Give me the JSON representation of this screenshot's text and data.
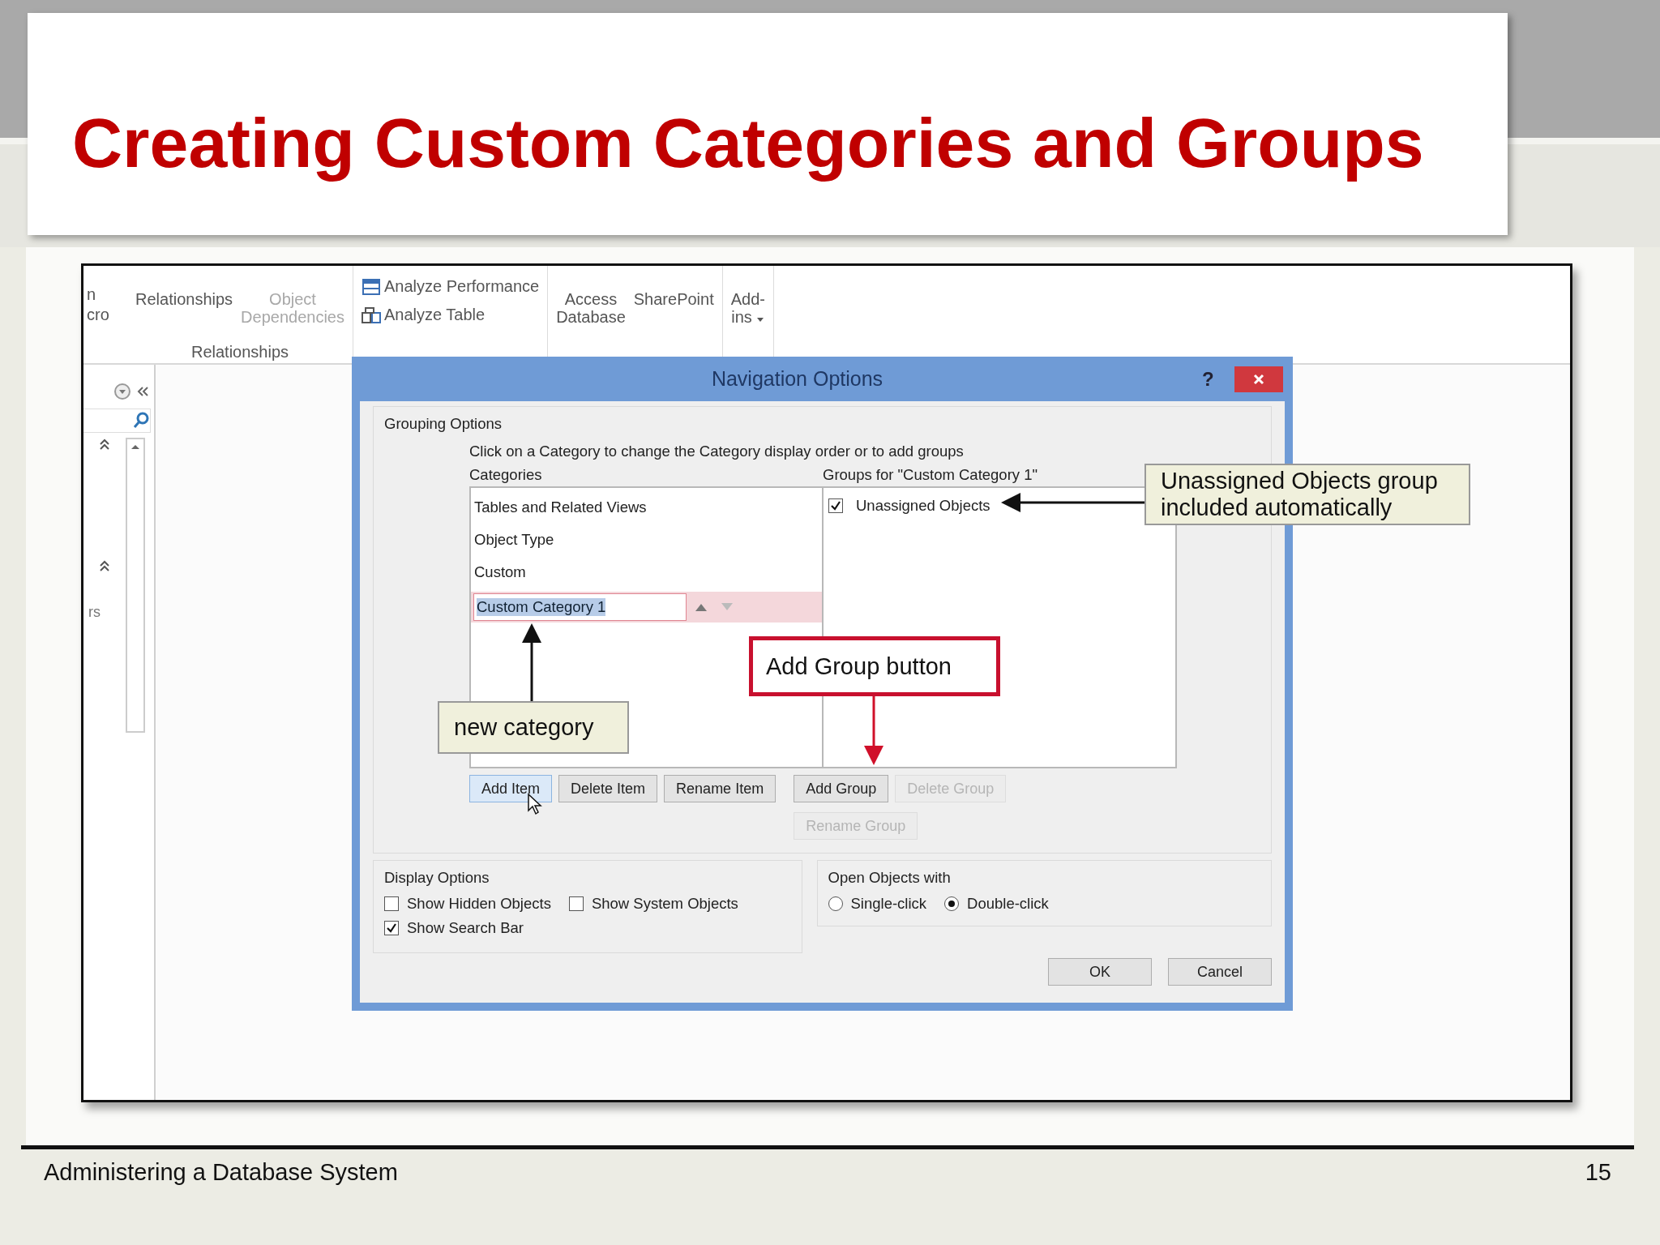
{
  "slide": {
    "title": "Creating Custom Categories and Groups",
    "footer": "Administering a Database System",
    "page_number": "15"
  },
  "ribbon": {
    "cut_labels": [
      "n",
      "cro"
    ],
    "groups": [
      {
        "label": "Relationships",
        "buttons": [
          {
            "lines": [
              "Relationships"
            ],
            "disabled": false,
            "dropdown": false
          },
          {
            "lines": [
              "Object",
              "Dependencies"
            ],
            "disabled": true,
            "dropdown": false
          }
        ]
      },
      {
        "small_buttons": [
          {
            "label": "Analyze Performance",
            "kind": "performance"
          },
          {
            "label": "Analyze Table",
            "kind": "table"
          }
        ]
      },
      {
        "buttons": [
          {
            "lines": [
              "Access",
              "Database"
            ],
            "disabled": false,
            "dropdown": false
          },
          {
            "lines": [
              "SharePoint"
            ],
            "disabled": false,
            "dropdown": false
          }
        ]
      },
      {
        "buttons": [
          {
            "lines": [
              "Add-",
              "ins"
            ],
            "disabled": false,
            "dropdown": true
          }
        ]
      }
    ]
  },
  "nav_pane": {
    "cut_label": "rs"
  },
  "dialog": {
    "title": "Navigation Options",
    "help": "?",
    "grouping": {
      "legend": "Grouping Options",
      "instruction": "Click on a Category to change the Category display order or to add groups",
      "categories_label": "Categories",
      "groups_label": "Groups for \"Custom Category 1\"",
      "categories": [
        {
          "label": "Tables and Related Views",
          "selected": false
        },
        {
          "label": "Object Type",
          "selected": false
        },
        {
          "label": "Custom",
          "selected": false
        },
        {
          "label": "Custom Category 1",
          "selected": true
        }
      ],
      "groups": [
        {
          "label": "Unassigned Objects",
          "checked": true
        }
      ],
      "category_buttons": [
        {
          "label": "Add Item",
          "disabled": false,
          "hovered": true
        },
        {
          "label": "Delete Item",
          "disabled": false,
          "hovered": false
        },
        {
          "label": "Rename Item",
          "disabled": false,
          "hovered": false
        }
      ],
      "group_buttons": [
        {
          "label": "Add Group",
          "disabled": false,
          "hovered": false
        },
        {
          "label": "Delete Group",
          "disabled": true,
          "hovered": false
        },
        {
          "label": "Rename Group",
          "disabled": true,
          "hovered": false
        }
      ]
    },
    "display_options": {
      "legend": "Display Options",
      "checkboxes": [
        {
          "label": "Show Hidden Objects",
          "checked": false
        },
        {
          "label": "Show System Objects",
          "checked": false
        },
        {
          "label": "Show Search Bar",
          "checked": true
        }
      ]
    },
    "open_objects": {
      "legend": "Open Objects with",
      "radios": [
        {
          "label": "Single-click",
          "selected": false
        },
        {
          "label": "Double-click",
          "selected": true
        }
      ]
    },
    "buttons": [
      "OK",
      "Cancel"
    ]
  },
  "callouts": [
    {
      "text": "Unassigned Objects group included automatically",
      "kind": "note"
    },
    {
      "text": "Add Group button",
      "kind": "highlight"
    },
    {
      "text": "new category",
      "kind": "note"
    }
  ]
}
